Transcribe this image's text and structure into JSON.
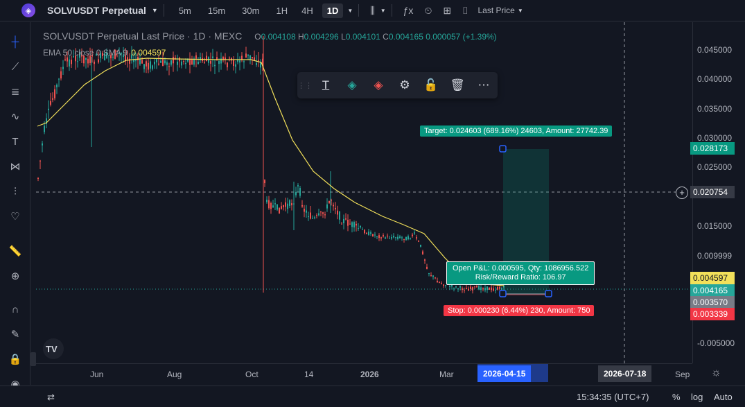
{
  "header": {
    "symbol": "SOLVUSDT Perpetual",
    "timeframes": [
      "5m",
      "15m",
      "30m",
      "1H",
      "4H",
      "1D"
    ],
    "active_timeframe": "1D",
    "last_price_menu": "Last Price"
  },
  "legend": {
    "title": "SOLVUSDT Perpetual Last Price · 1D · MEXC",
    "o_label": "O",
    "o": "0.004108",
    "h_label": "H",
    "h": "0.004296",
    "l_label": "L",
    "l": "0.004101",
    "c_label": "C",
    "c": "0.004165",
    "change": "0.000057 (+1.39%)",
    "indicator": "EMA 50 close 0 SMA 9",
    "indicator_value": "0.004597"
  },
  "position": {
    "target_label": "Target: 0.024603 (689.16%) 24603, Amount: 27742.39",
    "stop_label": "Stop: 0.000230 (6.44%) 230, Amount: 750",
    "pnl_line1": "Open P&L: 0.000595, Qty: 1086956.522",
    "pnl_line2": "Risk/Reward Ratio: 106.97"
  },
  "price_scale": {
    "ticks": [
      "0.045000",
      "0.040000",
      "0.035000",
      "0.030000",
      "0.025000",
      "0.015000",
      "0.009999",
      "-0.005000"
    ],
    "labels": {
      "target": "0.028173",
      "crosshair": "0.020754",
      "ema": "0.004597",
      "last": "0.004165",
      "entry": "0.003570",
      "stop": "0.003339"
    }
  },
  "time_axis": {
    "ticks": [
      "Jun",
      "Aug",
      "Oct",
      "14",
      "2026",
      "Mar",
      "Sep"
    ],
    "selected_date": "2026-04-15",
    "crosshair_date": "2026-07-18"
  },
  "bottom": {
    "clock": "15:34:35 (UTC+7)",
    "percent": "%",
    "log": "log",
    "auto": "Auto"
  },
  "colors": {
    "up": "#26a69a",
    "down": "#ef5350",
    "ema": "#f2e05a",
    "target": "#089981",
    "stop": "#f23645",
    "accent": "#2962ff"
  }
}
